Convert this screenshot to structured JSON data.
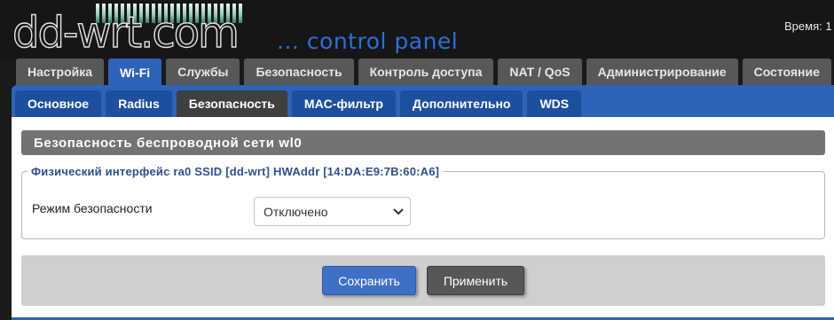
{
  "header": {
    "logo_text": "dd-wrt.com",
    "tagline": "... control panel",
    "time_label": "Время: 1"
  },
  "main_tabs": [
    {
      "label": "Настройка",
      "active": false
    },
    {
      "label": "Wi-Fi",
      "active": true
    },
    {
      "label": "Службы",
      "active": false
    },
    {
      "label": "Безопасность",
      "active": false
    },
    {
      "label": "Контроль доступа",
      "active": false
    },
    {
      "label": "NAT / QoS",
      "active": false
    },
    {
      "label": "Администрирование",
      "active": false
    },
    {
      "label": "Состояние",
      "active": false
    }
  ],
  "sub_tabs": [
    {
      "label": "Основное",
      "active": false
    },
    {
      "label": "Radius",
      "active": false
    },
    {
      "label": "Безопасность",
      "active": true
    },
    {
      "label": "MAC-фильтр",
      "active": false
    },
    {
      "label": "Дополнительно",
      "active": false
    },
    {
      "label": "WDS",
      "active": false
    }
  ],
  "section": {
    "title": "Безопасность беспроводной сети wl0",
    "interface_legend": "Физический интерфейс ra0 SSID [dd-wrt] HWAddr [14:DA:E9:7B:60:A6]",
    "security_mode_label": "Режим безопасности",
    "security_mode_value": "Отключено"
  },
  "buttons": {
    "save": "Сохранить",
    "apply": "Применить"
  },
  "colors": {
    "accent_blue": "#2e63b8",
    "tab_gray": "#585858",
    "tagline_blue": "#2d6fd6"
  }
}
